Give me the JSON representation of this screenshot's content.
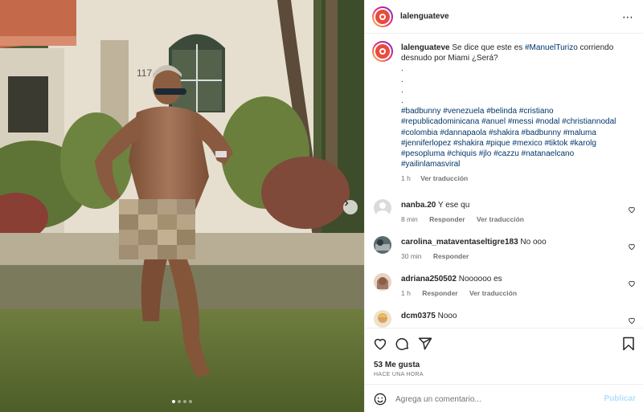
{
  "post": {
    "username": "lalenguateve",
    "more_icon": "⋯",
    "caption_user": "lalenguateve",
    "caption_pre": " Se dice que este es ",
    "caption_mention": "#ManuelTurizo",
    "caption_post": " corriendo desnudo por Miami ¿Será?",
    "caption_dots": [
      ".",
      ".",
      ".",
      "."
    ],
    "hashtags_lines": [
      "#badbunny #venezuela #belinda #cristiano",
      "#republicadominicana #anuel #messi #nodal #christiannodal",
      "#colombia #dannapaola #shakira #badbunny #maluma",
      "#jenniferlopez #shakira #pique #mexico #tiktok #karolg",
      "#pesopluma #chiquis #jlo #cazzu #natanaelcano",
      "#yailinlamasviral"
    ],
    "caption_time": "1 h",
    "caption_translate": "Ver traducción"
  },
  "comments": [
    {
      "user": "nanba.20",
      "text": "Y ese qu",
      "time": "8 min",
      "reply": "Responder",
      "translate": "Ver traducción"
    },
    {
      "user": "carolina_mataventaseltigre183",
      "text": "No ooo",
      "time": "30 min",
      "reply": "Responder",
      "translate": ""
    },
    {
      "user": "adriana250502",
      "text": "Noooooo es",
      "time": "1 h",
      "reply": "Responder",
      "translate": "Ver traducción"
    },
    {
      "user": "dcm0375",
      "text": "Nooo",
      "time": "",
      "reply": "",
      "translate": ""
    }
  ],
  "footer": {
    "likes": "53 Me gusta",
    "time_ago": "HACE UNA HORA",
    "comment_placeholder": "Agrega un comentario...",
    "post_label": "Publicar"
  },
  "icons": {
    "like": "heart-icon",
    "comment": "comment-icon",
    "share": "share-icon",
    "save": "bookmark-icon",
    "emoji": "emoji-icon",
    "next": "chevron-right-icon"
  },
  "colors": {
    "link": "#00376b",
    "muted": "#737373",
    "post_disabled": "#b2dffc"
  },
  "carousel": {
    "count": 4,
    "active": 1
  }
}
